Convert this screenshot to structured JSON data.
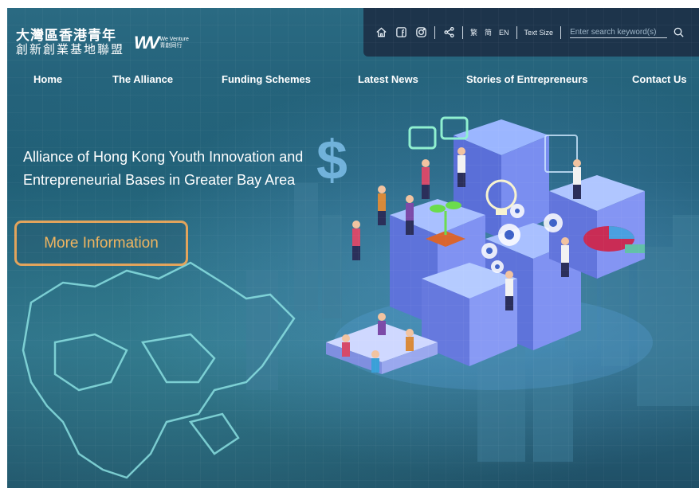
{
  "logo": {
    "line1": "大灣區香港青年",
    "line2": "創新創業基地聯盟",
    "mark": "WV",
    "mark_small1": "We Venture",
    "mark_small2": "青創同行"
  },
  "utility": {
    "icons": [
      "home-icon",
      "facebook-icon",
      "instagram-icon",
      "share-icon"
    ],
    "lang_trad": "繁",
    "lang_simp": "简",
    "lang_en": "EN",
    "text_size": "Text Size",
    "search_placeholder": "Enter search keyword(s)"
  },
  "nav": {
    "items": [
      "Home",
      "The Alliance",
      "Funding Schemes",
      "Latest News",
      "Stories of Entrepreneurs",
      "Contact Us"
    ]
  },
  "hero": {
    "title_line1": "Alliance of Hong Kong Youth Innovation and",
    "title_line2": "Entrepreneurial Bases in Greater Bay Area",
    "button": "More Information"
  },
  "colors": {
    "accent": "#e2a45c",
    "button_text": "#f0b560",
    "util_bg": "#1c3046",
    "background": "#1e5a73"
  }
}
